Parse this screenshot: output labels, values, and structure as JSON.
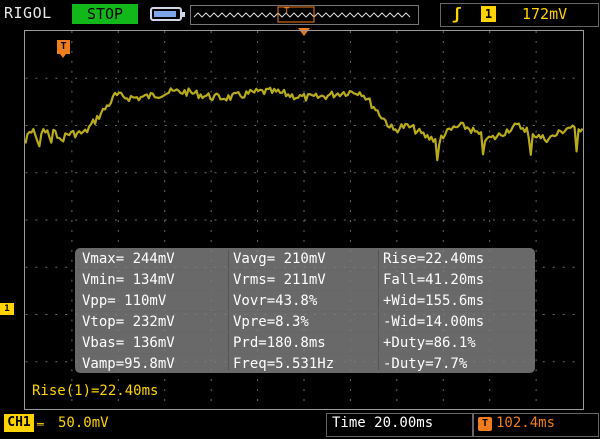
{
  "header": {
    "brand": "RIGOL",
    "run_state": "STOP",
    "trigger_edge_icon": "rising-edge-icon",
    "trigger_channel": "1",
    "trigger_level": "172mV"
  },
  "markers": {
    "trigger_position": "T",
    "channel_ground": "1"
  },
  "measurements": {
    "col1": [
      "Vmax= 244mV",
      "Vmin= 134mV",
      "Vpp= 110mV",
      "Vtop= 232mV",
      "Vbas= 136mV",
      "Vamp=95.8mV"
    ],
    "col2": [
      "Vavg= 210mV",
      "Vrms= 211mV",
      "Vovr=43.8%",
      "Vpre=8.3%",
      "Prd=180.8ms",
      "Freq=5.531Hz"
    ],
    "col3": [
      "Rise=22.40ms",
      "Fall=41.20ms",
      "+Wid=155.6ms",
      "-Wid=14.00ms",
      "+Duty=86.1%",
      "-Duty=7.7%"
    ]
  },
  "cursor_readout": "Rise(1)=22.40ms",
  "footer": {
    "channel_label": "CH1",
    "coupling_symbol": "═",
    "volts_per_div": "50.0mV",
    "timebase": "Time 20.00ms",
    "delay_icon": "T",
    "delay": "102.4ms"
  },
  "colors": {
    "trace": "#b8ac1c",
    "channel": "#ffd300",
    "trigger": "#f07d1d",
    "stop": "#12b81a"
  }
}
